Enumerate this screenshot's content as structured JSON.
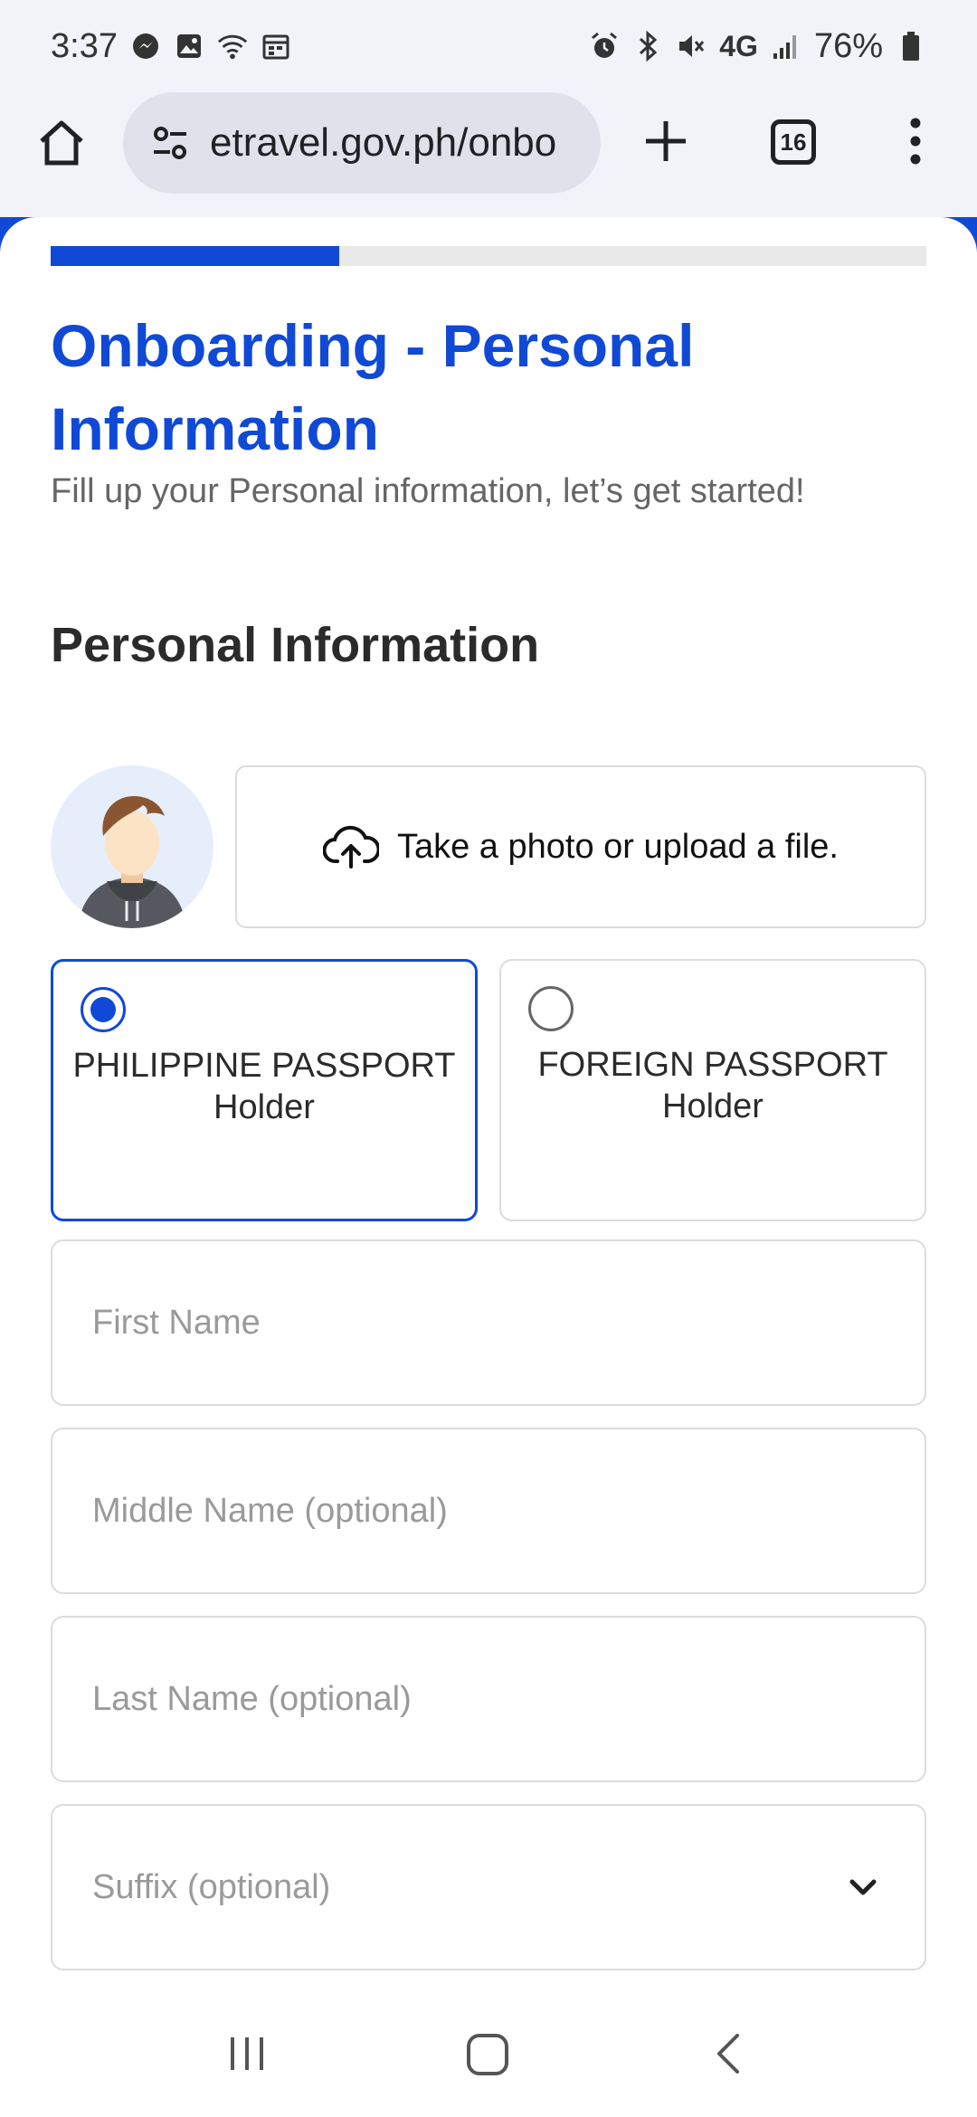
{
  "status_bar": {
    "time": "3:37",
    "network": "4G",
    "battery": "76%"
  },
  "browser": {
    "url": "etravel.gov.ph/onbo",
    "tab_count": "16"
  },
  "form": {
    "progress_percent": 33,
    "title": "Onboarding - Personal Information",
    "subtitle": "Fill up your Personal information, let’s get started!",
    "section_title": "Personal Information",
    "upload_label": "Take a photo or upload a file.",
    "passport_options": [
      {
        "label": "PHILIPPINE PASSPORT Holder",
        "selected": true
      },
      {
        "label": "FOREIGN PASSPORT Holder",
        "selected": false
      }
    ],
    "fields": {
      "first_name_placeholder": "First Name",
      "middle_name_placeholder": "Middle Name (optional)",
      "last_name_placeholder": "Last Name (optional)",
      "suffix_placeholder": "Suffix (optional)"
    }
  },
  "colors": {
    "accent": "#0f49d6",
    "progress_track": "#e9e9ea",
    "border": "#dcdcdc",
    "placeholder": "#9a9a9a"
  },
  "icons": [
    "messenger-icon",
    "gallery-icon",
    "wifi-icon",
    "calendar-icon",
    "alarm-icon",
    "bluetooth-icon",
    "mute-icon",
    "signal-icon",
    "battery-icon",
    "home-icon",
    "tune-icon",
    "plus-icon",
    "more-vert-icon",
    "cloud-upload-icon",
    "chevron-down-icon",
    "recents-icon",
    "home-nav-icon",
    "back-icon"
  ]
}
